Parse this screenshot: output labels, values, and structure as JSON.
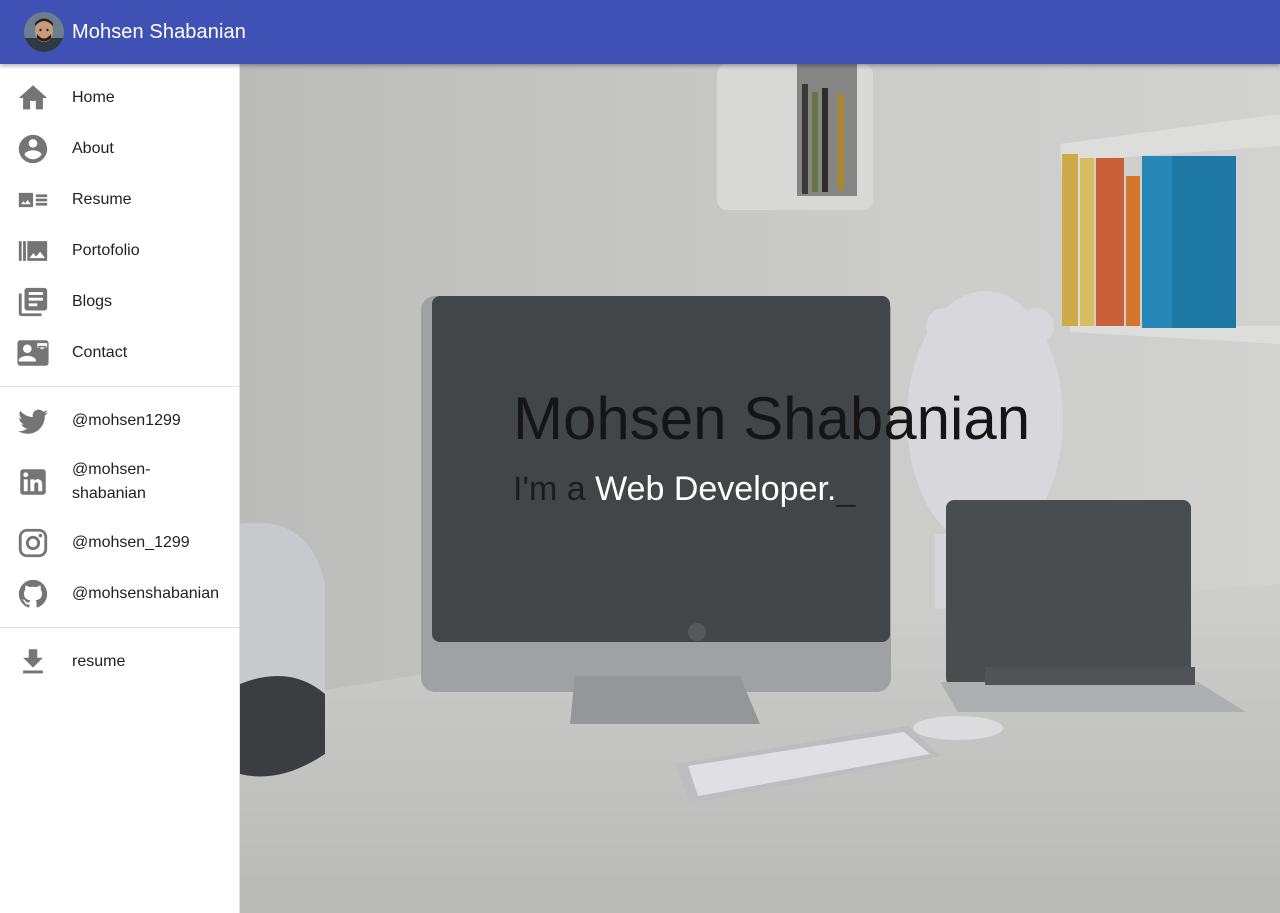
{
  "appbar": {
    "title": "Mohsen Shabanian",
    "avatar_icon": "profile-photo"
  },
  "drawer": {
    "nav": [
      {
        "label": "Home",
        "icon": "home-icon"
      },
      {
        "label": "About",
        "icon": "account-circle-icon"
      },
      {
        "label": "Resume",
        "icon": "featured-video-icon"
      },
      {
        "label": "Portofolio",
        "icon": "collections-icon"
      },
      {
        "label": "Blogs",
        "icon": "library-books-icon"
      },
      {
        "label": "Contact",
        "icon": "contact-mail-icon"
      }
    ],
    "social": [
      {
        "label": "@mohsen1299",
        "icon": "twitter-icon"
      },
      {
        "label": "@mohsen-shabanian",
        "icon": "linkedin-icon"
      },
      {
        "label": "@mohsen_1299",
        "icon": "instagram-icon"
      },
      {
        "label": "@mohsenshabanian",
        "icon": "github-icon"
      }
    ],
    "download": {
      "label": "resume",
      "icon": "download-icon"
    }
  },
  "hero": {
    "title": "Mohsen Shabanian",
    "subtitle_prefix": "I'm a",
    "typed_text": "Web Developer.",
    "cursor": "_"
  },
  "colors": {
    "appbar": "#3f51b5",
    "icon": "#757575",
    "text": "#212121"
  }
}
